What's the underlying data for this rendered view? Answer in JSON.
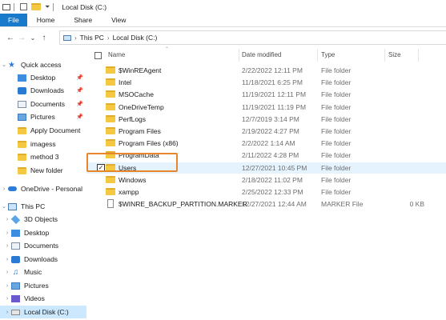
{
  "window": {
    "title": "Local Disk (C:)"
  },
  "ribbon": {
    "tabs": [
      "File",
      "Home",
      "Share",
      "View"
    ]
  },
  "address": {
    "crumbs": [
      "This PC",
      "Local Disk (C:)"
    ]
  },
  "nav": {
    "quick_access_label": "Quick access",
    "quick_access": [
      {
        "label": "Desktop",
        "icon": "desktop-icon",
        "pinned": true
      },
      {
        "label": "Downloads",
        "icon": "downloads-icon",
        "pinned": true
      },
      {
        "label": "Documents",
        "icon": "documents-icon",
        "pinned": true
      },
      {
        "label": "Pictures",
        "icon": "pictures-icon",
        "pinned": true
      },
      {
        "label": "Apply Document",
        "icon": "folder-icon",
        "pinned": false
      },
      {
        "label": "imagess",
        "icon": "folder-icon",
        "pinned": false
      },
      {
        "label": "method 3",
        "icon": "folder-icon",
        "pinned": false
      },
      {
        "label": "New folder",
        "icon": "folder-icon",
        "pinned": false
      }
    ],
    "onedrive_label": "OneDrive - Personal",
    "this_pc_label": "This PC",
    "this_pc": [
      {
        "label": "3D Objects",
        "icon": "3d-objects-icon"
      },
      {
        "label": "Desktop",
        "icon": "desktop-icon"
      },
      {
        "label": "Documents",
        "icon": "documents-icon"
      },
      {
        "label": "Downloads",
        "icon": "downloads-icon"
      },
      {
        "label": "Music",
        "icon": "music-icon"
      },
      {
        "label": "Pictures",
        "icon": "pictures-icon"
      },
      {
        "label": "Videos",
        "icon": "videos-icon"
      },
      {
        "label": "Local Disk (C:)",
        "icon": "drive-icon",
        "selected": true
      }
    ]
  },
  "columns": {
    "name": "Name",
    "date": "Date modified",
    "type": "Type",
    "size": "Size"
  },
  "files": [
    {
      "name": "$WinREAgent",
      "date": "2/22/2022 12:11 PM",
      "type": "File folder",
      "size": "",
      "kind": "folder"
    },
    {
      "name": "Intel",
      "date": "11/18/2021 6:25 PM",
      "type": "File folder",
      "size": "",
      "kind": "folder"
    },
    {
      "name": "MSOCache",
      "date": "11/19/2021 12:11 PM",
      "type": "File folder",
      "size": "",
      "kind": "folder"
    },
    {
      "name": "OneDriveTemp",
      "date": "11/19/2021 11:19 PM",
      "type": "File folder",
      "size": "",
      "kind": "folder"
    },
    {
      "name": "PerfLogs",
      "date": "12/7/2019 3:14 PM",
      "type": "File folder",
      "size": "",
      "kind": "folder"
    },
    {
      "name": "Program Files",
      "date": "2/19/2022 4:27 PM",
      "type": "File folder",
      "size": "",
      "kind": "folder"
    },
    {
      "name": "Program Files (x86)",
      "date": "2/2/2022 1:14 AM",
      "type": "File folder",
      "size": "",
      "kind": "folder"
    },
    {
      "name": "ProgramData",
      "date": "2/11/2022 4:28 PM",
      "type": "File folder",
      "size": "",
      "kind": "folder"
    },
    {
      "name": "Users",
      "date": "12/27/2021 10:45 PM",
      "type": "File folder",
      "size": "",
      "kind": "folder",
      "selected": true,
      "check": "✓"
    },
    {
      "name": "Windows",
      "date": "2/18/2022 11:02 PM",
      "type": "File folder",
      "size": "",
      "kind": "folder"
    },
    {
      "name": "xampp",
      "date": "2/25/2022 12:33 PM",
      "type": "File folder",
      "size": "",
      "kind": "folder"
    },
    {
      "name": "$WINRE_BACKUP_PARTITION.MARKER",
      "date": "12/27/2021 12:44 AM",
      "type": "MARKER File",
      "size": "0 KB",
      "kind": "file"
    }
  ],
  "glyphs": {
    "back": "←",
    "forward": "→",
    "dropdown": "⌄",
    "up": "↑",
    "chevron_right": "›",
    "chevron_down": "⌄",
    "star": "★",
    "pin": "📌",
    "note": "♫"
  }
}
